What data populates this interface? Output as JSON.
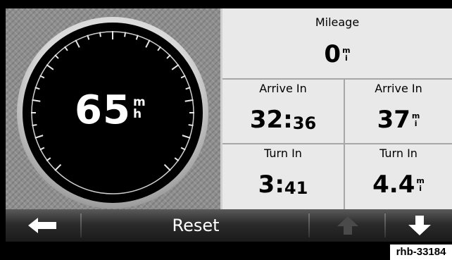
{
  "speedometer": {
    "speed": "65",
    "unit_top": "m",
    "unit_bottom": "h"
  },
  "fields": {
    "mileage": {
      "label": "Mileage",
      "value": "0",
      "unit_top": "m",
      "unit_bottom": "i"
    },
    "arrive_time": {
      "label": "Arrive In",
      "value_main": "32:",
      "value_small": "36"
    },
    "arrive_distance": {
      "label": "Arrive In",
      "value": "37",
      "unit_top": "m",
      "unit_bottom": "i"
    },
    "turn_time": {
      "label": "Turn In",
      "value_main": "3:",
      "value_small": "41"
    },
    "turn_distance": {
      "label": "Turn In",
      "value": "4.4",
      "unit_top": "m",
      "unit_bottom": "i"
    }
  },
  "bottom_bar": {
    "back_icon": "left-arrow-icon",
    "reset_label": "Reset",
    "up_icon": "up-arrow-icon",
    "down_icon": "down-arrow-icon"
  },
  "figure_tag": "rhb-33184",
  "colors": {
    "panel_light": "#e9e9e9",
    "dial_face": "#000000",
    "bar_dark": "#1a1a1a"
  }
}
